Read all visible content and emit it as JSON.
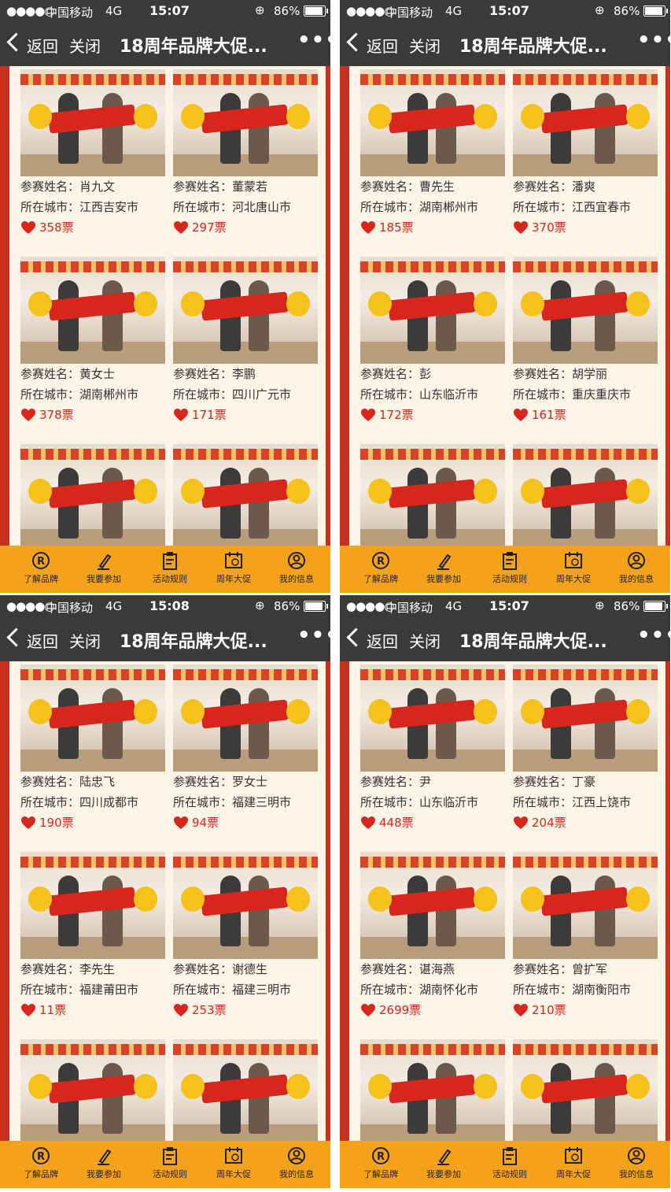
{
  "status": {
    "carrier": "中国移动",
    "network": "4G",
    "battery_text": "86%"
  },
  "nav": {
    "back": "返回",
    "close": "关闭",
    "title": "18周年品牌大促...",
    "more": "•••"
  },
  "labels": {
    "name_prefix": "参赛姓名：",
    "city_prefix": "所在城市：",
    "vote_suffix": "票"
  },
  "tabs": [
    {
      "label": "了解品牌",
      "icon": "registered-icon"
    },
    {
      "label": "我要参加",
      "icon": "pen-icon"
    },
    {
      "label": "活动规则",
      "icon": "clipboard-icon"
    },
    {
      "label": "周年大促",
      "icon": "calendar-icon"
    },
    {
      "label": "我的信息",
      "icon": "user-icon"
    }
  ],
  "colors": {
    "bar": "#3a3a3a",
    "accent": "#d9261c",
    "tab": "#f5a21b",
    "border": "#c9311d"
  },
  "panels": [
    {
      "time": "15:07",
      "entries": [
        {
          "name": "肖九文",
          "city": "江西吉安市",
          "votes": "358"
        },
        {
          "name": "董蒙若",
          "city": "河北唐山市",
          "votes": "297"
        },
        {
          "name": "黄女士",
          "city": "湖南郴州市",
          "votes": "378"
        },
        {
          "name": "李鹏",
          "city": "四川广元市",
          "votes": "171"
        }
      ]
    },
    {
      "time": "15:07",
      "entries": [
        {
          "name": "曹先生",
          "city": "湖南郴州市",
          "votes": "185"
        },
        {
          "name": "潘爽",
          "city": "江西宜春市",
          "votes": "370"
        },
        {
          "name": "彭",
          "city": "山东临沂市",
          "votes": "172"
        },
        {
          "name": "胡学丽",
          "city": "重庆重庆市",
          "votes": "161"
        }
      ]
    },
    {
      "time": "15:08",
      "entries": [
        {
          "name": "陆忠飞",
          "city": "四川成都市",
          "votes": "190"
        },
        {
          "name": "罗女士",
          "city": "福建三明市",
          "votes": "94"
        },
        {
          "name": "李先生",
          "city": "福建莆田市",
          "votes": "11"
        },
        {
          "name": "谢德生",
          "city": "福建三明市",
          "votes": "253"
        }
      ]
    },
    {
      "time": "15:07",
      "entries": [
        {
          "name": "尹",
          "city": "山东临沂市",
          "votes": "448"
        },
        {
          "name": "丁豪",
          "city": "江西上饶市",
          "votes": "204"
        },
        {
          "name": "谌海燕",
          "city": "湖南怀化市",
          "votes": "2699"
        },
        {
          "name": "曾扩军",
          "city": "湖南衡阳市",
          "votes": "210"
        }
      ]
    }
  ]
}
